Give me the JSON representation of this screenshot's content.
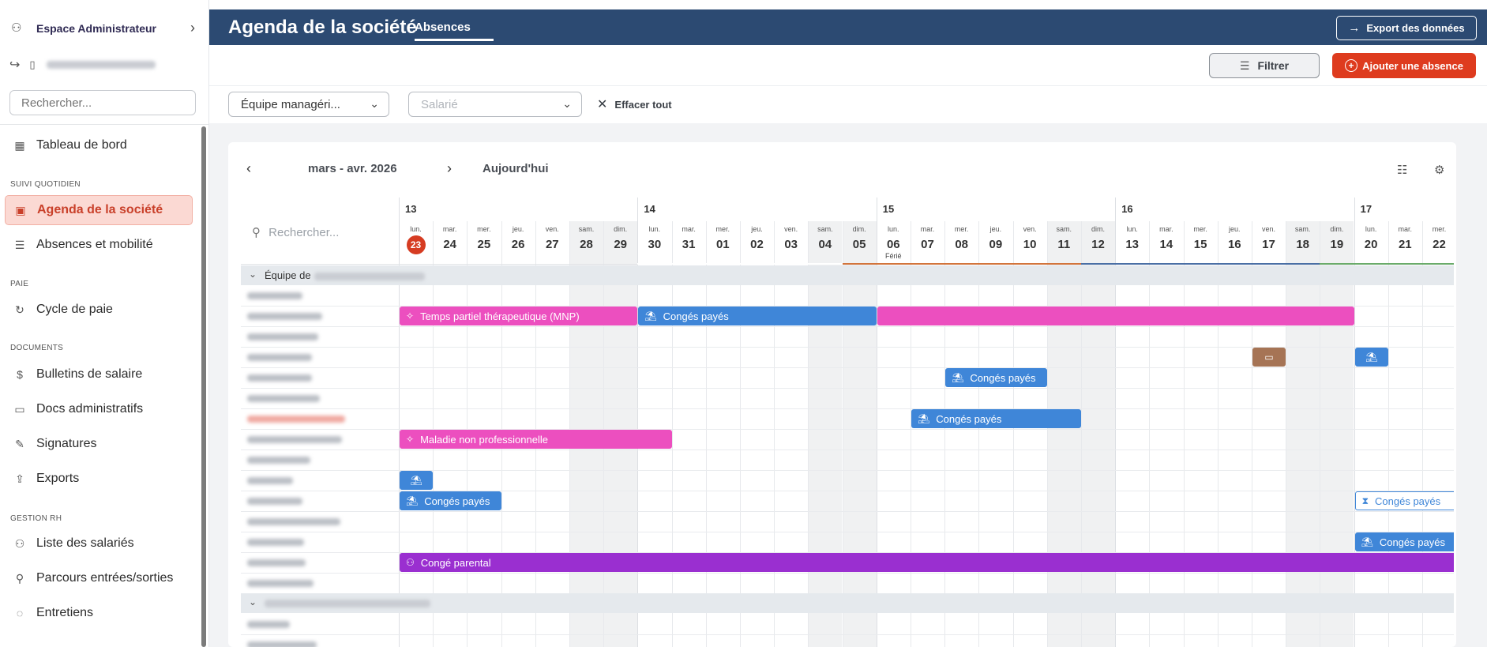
{
  "sidebar": {
    "admin_title": "Espace Administrateur",
    "search_placeholder": "Rechercher...",
    "items": {
      "dashboard": "Tableau de bord",
      "agenda": "Agenda de la société",
      "absences": "Absences et mobilité",
      "payroll_cycle": "Cycle de paie",
      "payslips": "Bulletins de salaire",
      "admin_docs": "Docs administratifs",
      "signatures": "Signatures",
      "exports": "Exports",
      "employees": "Liste des salariés",
      "journeys": "Parcours entrées/sorties",
      "interviews": "Entretiens"
    },
    "sections": {
      "daily": "SUIVI QUOTIDIEN",
      "pay": "PAIE",
      "documents": "DOCUMENTS",
      "hr": "GESTION RH"
    }
  },
  "header": {
    "title": "Agenda de la société",
    "tab": "Absences",
    "export_label": "Export des données"
  },
  "toolbar": {
    "filter_label": "Filtrer",
    "add_label": "Ajouter une absence"
  },
  "filters": {
    "team_value": "Équipe managéri...",
    "employee_placeholder": "Salarié",
    "clear_label": "Effacer tout"
  },
  "calendar": {
    "range": "mars - avr. 2026",
    "today_label": "Aujourd'hui",
    "search_placeholder": "Rechercher...",
    "weeks": [
      "13",
      "14",
      "15",
      "16",
      "17"
    ],
    "days": [
      {
        "dow": "lun.",
        "num": "23",
        "today": true
      },
      {
        "dow": "mar.",
        "num": "24"
      },
      {
        "dow": "mer.",
        "num": "25"
      },
      {
        "dow": "jeu.",
        "num": "26"
      },
      {
        "dow": "ven.",
        "num": "27"
      },
      {
        "dow": "sam.",
        "num": "28",
        "weekend": true
      },
      {
        "dow": "dim.",
        "num": "29",
        "weekend": true
      },
      {
        "dow": "lun.",
        "num": "30"
      },
      {
        "dow": "mar.",
        "num": "31"
      },
      {
        "dow": "mer.",
        "num": "01"
      },
      {
        "dow": "jeu.",
        "num": "02"
      },
      {
        "dow": "ven.",
        "num": "03"
      },
      {
        "dow": "sam.",
        "num": "04",
        "weekend": true
      },
      {
        "dow": "dim.",
        "num": "05",
        "weekend": true
      },
      {
        "dow": "lun.",
        "num": "06",
        "holiday": "Férié"
      },
      {
        "dow": "mar.",
        "num": "07"
      },
      {
        "dow": "mer.",
        "num": "08"
      },
      {
        "dow": "jeu.",
        "num": "09"
      },
      {
        "dow": "ven.",
        "num": "10"
      },
      {
        "dow": "sam.",
        "num": "11",
        "weekend": true
      },
      {
        "dow": "dim.",
        "num": "12",
        "weekend": true
      },
      {
        "dow": "lun.",
        "num": "13"
      },
      {
        "dow": "mar.",
        "num": "14"
      },
      {
        "dow": "mer.",
        "num": "15"
      },
      {
        "dow": "jeu.",
        "num": "16"
      },
      {
        "dow": "ven.",
        "num": "17"
      },
      {
        "dow": "sam.",
        "num": "18",
        "weekend": true
      },
      {
        "dow": "dim.",
        "num": "19",
        "weekend": true
      },
      {
        "dow": "lun.",
        "num": "20"
      },
      {
        "dow": "mar.",
        "num": "21"
      },
      {
        "dow": "mer.",
        "num": "22"
      }
    ],
    "group1_label": "Équipe de",
    "events": {
      "tpt": "Temps partiel thérapeutique (MNP)",
      "cp": "Congés payés",
      "maladie": "Maladie non professionnelle",
      "parental": "Congé parental"
    },
    "colors": {
      "blue": "#3f86d8",
      "pink": "#ec4fbf",
      "brown": "#a67455",
      "purple": "#9a2fd0",
      "accent": "#de3b1e",
      "header": "#2c4a72"
    }
  }
}
